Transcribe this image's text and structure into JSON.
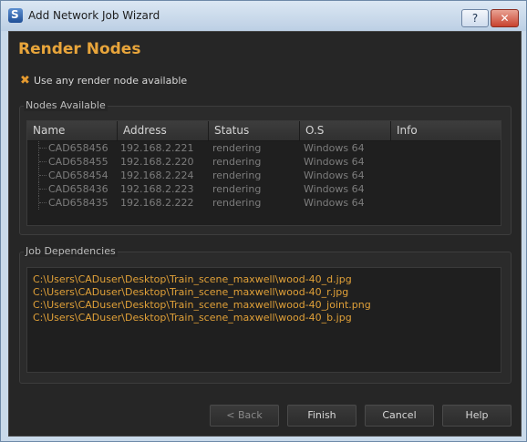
{
  "window": {
    "title": "Add Network Job Wizard",
    "help_glyph": "?",
    "close_glyph": "✕"
  },
  "page": {
    "heading": "Render Nodes"
  },
  "option": {
    "use_any_label": "Use any render node available",
    "checked_glyph": "✖"
  },
  "nodes": {
    "group_label": "Nodes Available",
    "columns": [
      "Name",
      "Address",
      "Status",
      "O.S",
      "Info"
    ],
    "rows": [
      {
        "name": "CAD658456",
        "address": "192.168.2.221",
        "status": "rendering",
        "os": "Windows 64",
        "info": ""
      },
      {
        "name": "CAD658455",
        "address": "192.168.2.220",
        "status": "rendering",
        "os": "Windows 64",
        "info": ""
      },
      {
        "name": "CAD658454",
        "address": "192.168.2.224",
        "status": "rendering",
        "os": "Windows 64",
        "info": ""
      },
      {
        "name": "CAD658436",
        "address": "192.168.2.223",
        "status": "rendering",
        "os": "Windows 64",
        "info": ""
      },
      {
        "name": "CAD658435",
        "address": "192.168.2.222",
        "status": "rendering",
        "os": "Windows 64",
        "info": ""
      }
    ]
  },
  "dependencies": {
    "group_label": "Job Dependencies",
    "files": [
      "C:\\Users\\CADuser\\Desktop\\Train_scene_maxwell\\wood-40_d.jpg",
      "C:\\Users\\CADuser\\Desktop\\Train_scene_maxwell\\wood-40_r.jpg",
      "C:\\Users\\CADuser\\Desktop\\Train_scene_maxwell\\wood-40_joint.png",
      "C:\\Users\\CADuser\\Desktop\\Train_scene_maxwell\\wood-40_b.jpg"
    ]
  },
  "buttons": {
    "back": "< Back",
    "finish": "Finish",
    "cancel": "Cancel",
    "help": "Help"
  },
  "colors": {
    "accent": "#e8a53b",
    "background": "#262626",
    "title_bar": "#c9daea"
  }
}
